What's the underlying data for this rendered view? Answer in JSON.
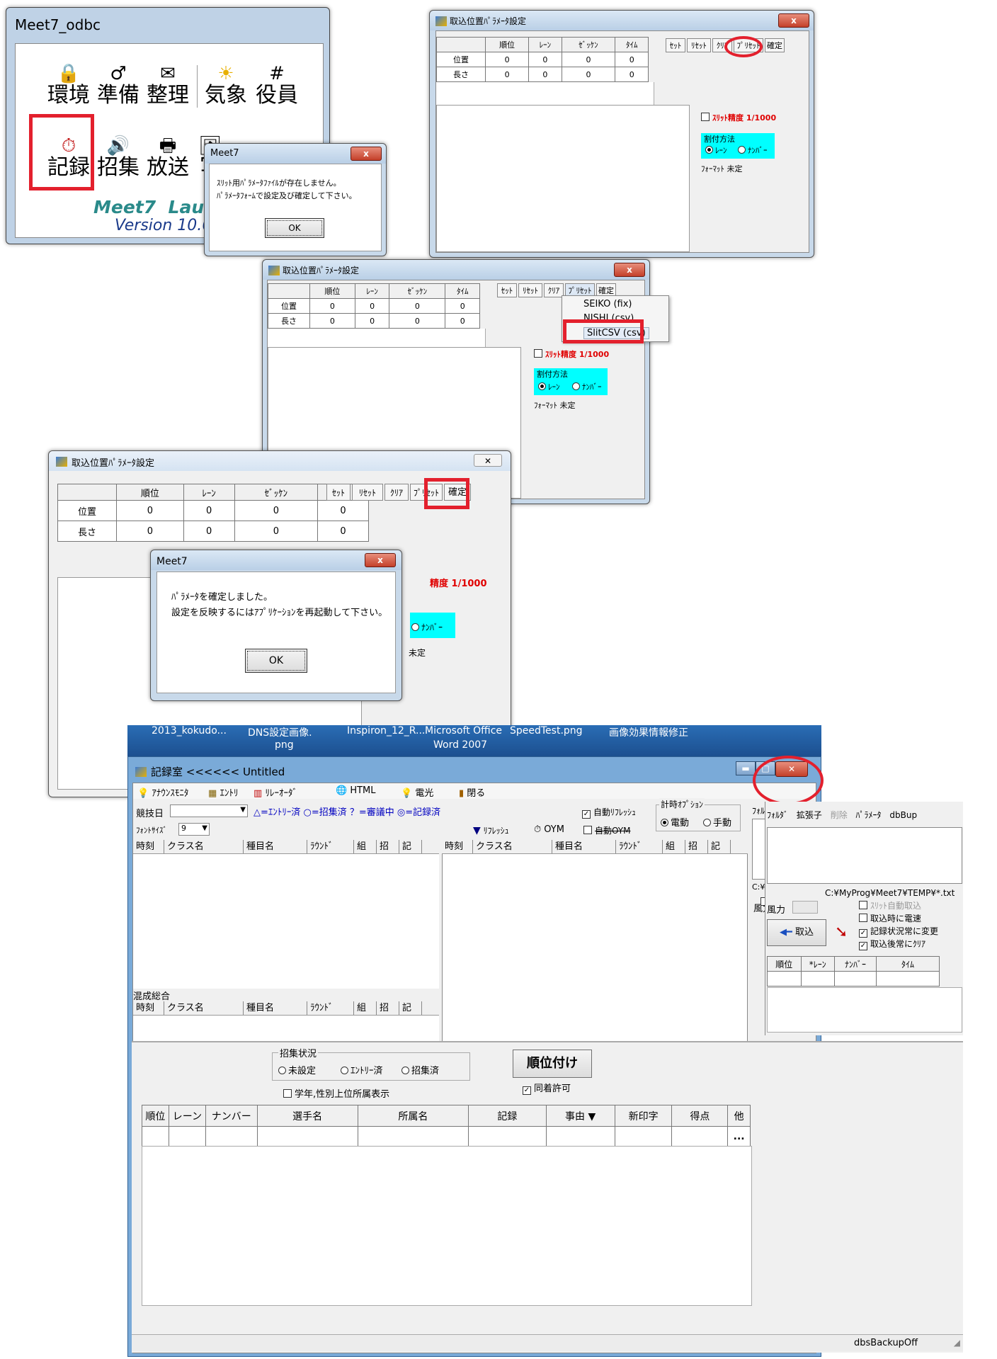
{
  "launcher": {
    "title": "Meet7_odbc",
    "row1": [
      {
        "icon": "🔒",
        "label": "環境",
        "name": "env"
      },
      {
        "icon": "♂",
        "label": "準備",
        "name": "prep"
      },
      {
        "icon": "✉",
        "label": "整理",
        "name": "arrange"
      },
      {
        "icon": "☀",
        "label": "気象",
        "name": "weather"
      },
      {
        "icon": "#",
        "label": "役員",
        "name": "officers"
      }
    ],
    "row2": [
      {
        "icon": "⏱",
        "label": "記録",
        "name": "record"
      },
      {
        "icon": "🔊",
        "label": "招集",
        "name": "call"
      },
      {
        "icon": "🖶",
        "label": "放送",
        "name": "broadcast"
      },
      {
        "icon": "🖼",
        "label": "写",
        "name": "photo"
      }
    ],
    "brand": "Meet7  Laun",
    "version": "Version 10.6"
  },
  "dialog1": {
    "title": "Meet7",
    "close": "x",
    "line1": "ｽﾘｯﾄ用ﾊﾟﾗﾒｰﾀﾌｧｲﾙが存在しません。",
    "line2": "ﾊﾟﾗﾒｰﾀﾌｫｰﾑで設定及び確定して下さい。",
    "ok": "OK"
  },
  "param": {
    "title": "取込位置ﾊﾟﾗﾒｰﾀ設定",
    "close": "x",
    "cols": [
      "順位",
      "ﾚｰﾝ",
      "ｾﾞｯｹﾝ",
      "ﾀｲﾑ"
    ],
    "rows": [
      {
        "label": "位置",
        "values": [
          "0",
          "0",
          "0",
          "0"
        ]
      },
      {
        "label": "長さ",
        "values": [
          "0",
          "0",
          "0",
          "0"
        ]
      }
    ],
    "buttons": [
      "ｾｯﾄ",
      "ﾘｾｯﾄ",
      "ｸﾘｱ",
      "ﾌﾟﾘｾｯﾄ",
      "確定"
    ],
    "slit_precision": "ｽﾘｯﾄ精度 1/1000",
    "alloc_title": "割付方法",
    "alloc_lane": "ﾚｰﾝ",
    "alloc_number": "ﾅﾝﾊﾞｰ",
    "format": "ﾌｫｰﾏｯﾄ 未定"
  },
  "preset_menu": [
    "SEIKO (fix)",
    "NISHI (csv)",
    "SlitCSV (csv)"
  ],
  "dialog2": {
    "title": "Meet7",
    "close": "x",
    "line1": "ﾊﾟﾗﾒｰﾀを確定しました。",
    "line2": "設定を反映するにはｱﾌﾟﾘｹｰｼｮﾝを再起動して下さい。",
    "ok": "OK"
  },
  "bg": {
    "param_partial_precision": "精度 1/1000",
    "param_partial_number": "ﾅﾝﾊﾞｰ",
    "param_partial_format": "未定",
    "taskbar": [
      "2013_kokudo...",
      "DNS設定画像.",
      "Inspiron_12_R...",
      "Microsoft Office",
      "SpeedTest.png",
      "画像効果情報修正"
    ],
    "taskbar2": [
      "png",
      "Word 2007"
    ]
  },
  "records": {
    "title": "記録室 <<<<<< Untitled",
    "menu": [
      "ｱﾅｳﾝｽﾓﾆﾀ",
      "ｴﾝﾄﾘ",
      "ﾘﾚｰｵｰﾀﾞ",
      "HTML",
      "電光",
      "閉る"
    ],
    "date_label": "競技日",
    "legend": "△=ｴﾝﾄﾘｰ済 ○=招集済 ？=審議中 ◎=記録済",
    "font_size_label": "ﾌｫﾝﾄｻｲｽﾞ",
    "font_size": "9",
    "auto_refresh": "自動ﾘﾌﾚｯｼｭ",
    "timing_option": "計時ｵﾌﾟｼｮﾝ",
    "electric": "電動",
    "manual": "手動",
    "refresh": "ﾘﾌﾚｯｼｭ",
    "oym": "OYM",
    "auto_oym": "自動OYM",
    "list_cols": [
      "時刻",
      "クラス名",
      "種目名",
      "ﾗｳﾝﾄﾞ",
      "組",
      "招",
      "記"
    ],
    "mixed_label": "混成総合",
    "right_tabs": [
      "ﾌｫﾙﾀﾞ",
      "拡張子",
      "削除",
      "ﾊﾟﾗﾒｰﾀ",
      "dbBup"
    ],
    "path": "C:¥MyProg¥Meet7¥TEMP¥*.txt",
    "wind": "風力",
    "slit_auto": "ｽﾘｯﾄ自動取込",
    "import_wind": "取込時に電速",
    "always_change": "記録状況常に変更",
    "clear_after": "取込後常にｸﾘｱ",
    "import_btn": "取込",
    "small_cols": [
      "順位",
      "*ﾚｰﾝ",
      "ﾅﾝﾊﾞｰ",
      "ﾀｲﾑ"
    ],
    "call_status": "招集状況",
    "unset": "未設定",
    "entry_done": "ｴﾝﾄﾘｰ済",
    "called": "招集済",
    "rank_btn": "順位付け",
    "same_rank": "同着許可",
    "grade_display": "学年,性別上位所属表示",
    "result_cols": [
      "順位",
      "レーン",
      "ナンバー",
      "選手名",
      "所属名",
      "記録",
      "事由 ▼",
      "新印字",
      "得点",
      "他"
    ],
    "ellipsis": "...",
    "status": "dbsBackupOff"
  }
}
